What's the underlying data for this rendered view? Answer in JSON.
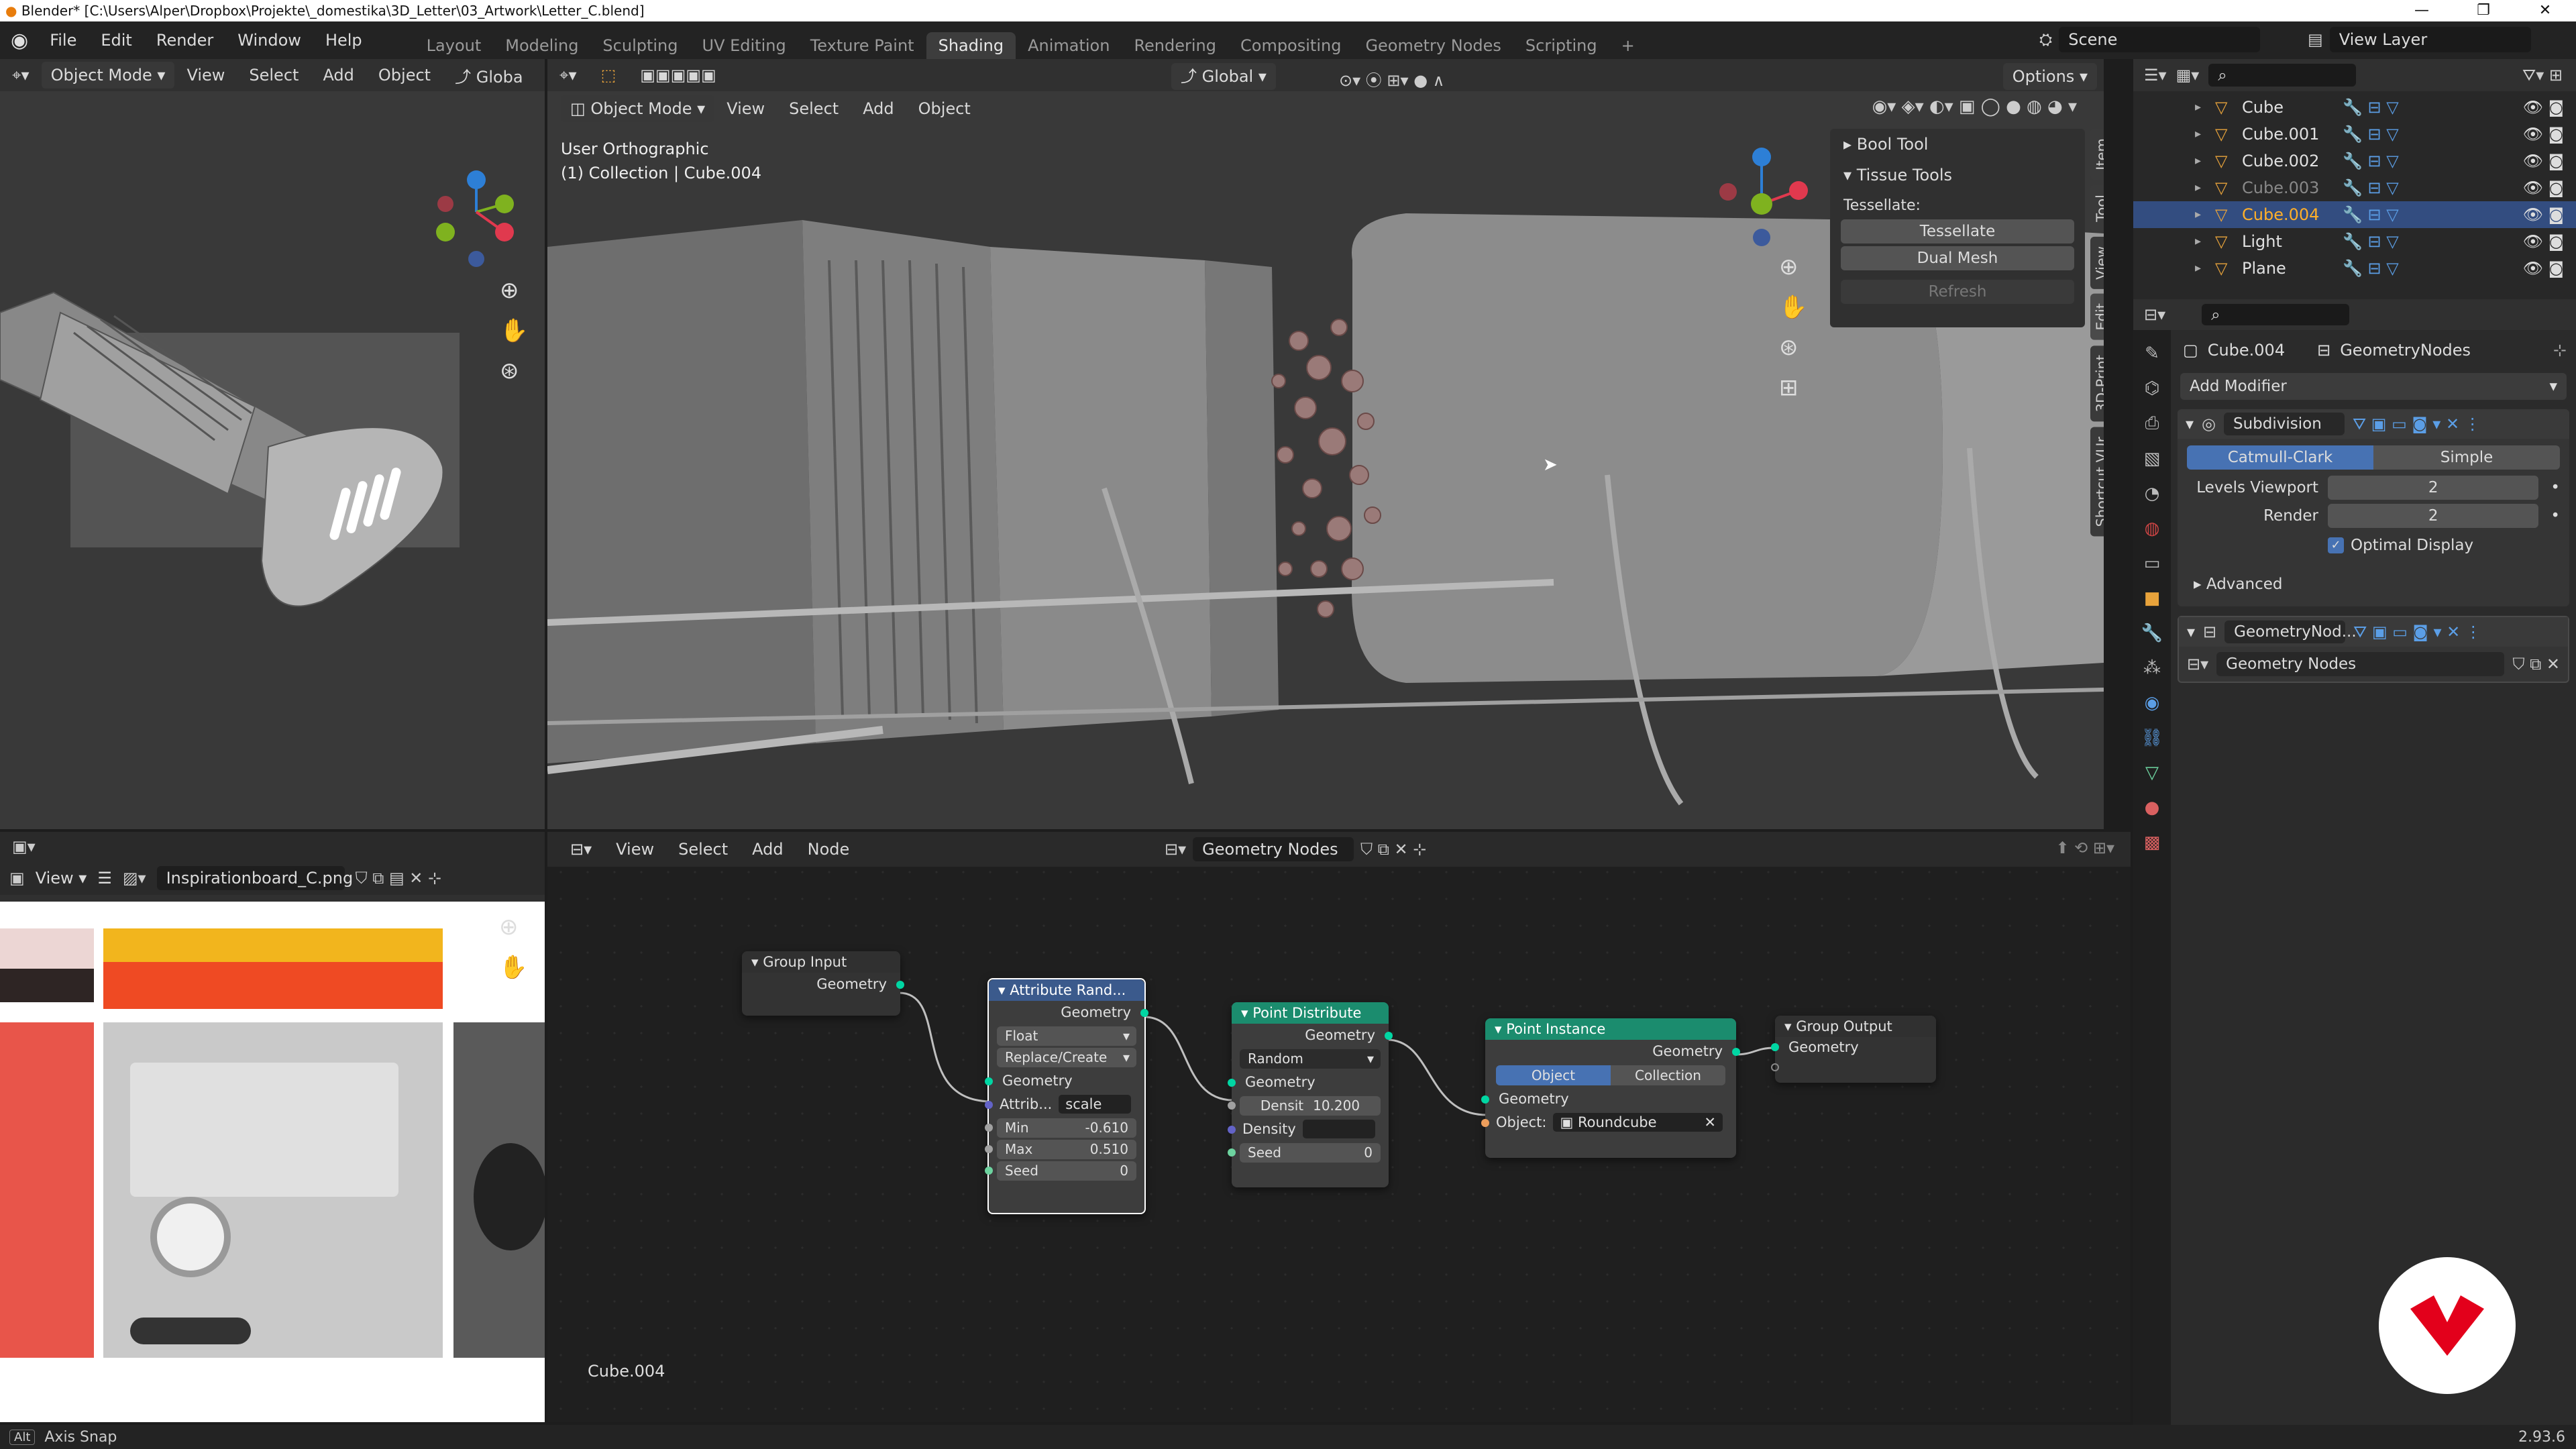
{
  "window": {
    "title": "Blender* [C:\\Users\\Alper\\Dropbox\\Projekte\\_domestika\\3D_Letter\\03_Artwork\\Letter_C.blend]",
    "controls": [
      "—",
      "❐",
      "✕"
    ]
  },
  "menubar": [
    "File",
    "Edit",
    "Render",
    "Window",
    "Help"
  ],
  "workspace_tabs": [
    {
      "label": "Layout",
      "active": false
    },
    {
      "label": "Modeling",
      "active": false
    },
    {
      "label": "Sculpting",
      "active": false
    },
    {
      "label": "UV Editing",
      "active": false
    },
    {
      "label": "Texture Paint",
      "active": false
    },
    {
      "label": "Shading",
      "active": true
    },
    {
      "label": "Animation",
      "active": false
    },
    {
      "label": "Rendering",
      "active": false
    },
    {
      "label": "Compositing",
      "active": false
    },
    {
      "label": "Geometry Nodes",
      "active": false
    },
    {
      "label": "Scripting",
      "active": false
    }
  ],
  "scene": {
    "name": "Scene",
    "view_layer": "View Layer"
  },
  "left_viewport": {
    "mode": "Object Mode",
    "menus": [
      "View",
      "Select",
      "Add",
      "Object"
    ],
    "transform": "Globa"
  },
  "main_viewport": {
    "mode": "Object Mode",
    "menus": [
      "View",
      "Select",
      "Add",
      "Object"
    ],
    "transform_orientation": "Global",
    "options_label": "Options",
    "view_name": "User Orthographic",
    "collection_label": "(1) Collection | Cube.004",
    "sidebar": {
      "bool_tool": "Bool Tool",
      "tissue_tools": "Tissue Tools",
      "tessellate_label": "Tessellate:",
      "buttons": [
        "Tessellate",
        "Dual Mesh",
        "Refresh"
      ]
    },
    "side_tabs": [
      "Item",
      "Tool",
      "View",
      "Edit",
      "3D-Print",
      "Shortcut VUr"
    ]
  },
  "outliner": {
    "items": [
      {
        "name": "Cube",
        "icon": "mesh-object-icon",
        "dim": false,
        "selected": false
      },
      {
        "name": "Cube.001",
        "icon": "mesh-object-icon",
        "dim": false,
        "selected": false
      },
      {
        "name": "Cube.002",
        "icon": "curve-object-icon",
        "dim": false,
        "selected": false
      },
      {
        "name": "Cube.003",
        "icon": "mesh-object-icon",
        "dim": true,
        "selected": false
      },
      {
        "name": "Cube.004",
        "icon": "mesh-object-icon",
        "dim": false,
        "selected": true
      },
      {
        "name": "Light",
        "icon": "light-object-icon",
        "dim": false,
        "selected": false
      },
      {
        "name": "Plane",
        "icon": "mesh-object-icon",
        "dim": false,
        "selected": false
      }
    ]
  },
  "properties": {
    "object_name": "Cube.004",
    "modifier_context": "GeometryNodes",
    "add_modifier": "Add Modifier",
    "subdivision": {
      "name": "Subdivision",
      "type_a": "Catmull-Clark",
      "type_b": "Simple",
      "levels_viewport_label": "Levels Viewport",
      "levels_viewport": "2",
      "render_label": "Render",
      "render": "2",
      "optimal_display": "Optimal Display",
      "advanced": "Advanced"
    },
    "geonodes": {
      "name": "GeometryNod...",
      "tree": "Geometry Nodes"
    }
  },
  "image_editor": {
    "view_menu": "View",
    "image_name": "Inspirationboard_C.png"
  },
  "node_editor": {
    "menus": [
      "View",
      "Select",
      "Add",
      "Node"
    ],
    "tree_name": "Geometry Nodes",
    "object_label": "Cube.004",
    "nodes": {
      "group_input": {
        "title": "Group Input",
        "out": "Geometry"
      },
      "attr_random": {
        "title": "Attribute Rand...",
        "out": "Geometry",
        "type": "Float",
        "mode": "Replace/Create",
        "in_geo": "Geometry",
        "attr_label": "Attrib...",
        "attr_value": "scale",
        "min_label": "Min",
        "min": "-0.610",
        "max_label": "Max",
        "max": "0.510",
        "seed_label": "Seed",
        "seed": "0"
      },
      "point_distribute": {
        "title": "Point Distribute",
        "out": "Geometry",
        "mode": "Random",
        "in_geo": "Geometry",
        "density_label": "Densit",
        "density": "10.200",
        "density2_label": "Density",
        "seed_label": "Seed",
        "seed": "0"
      },
      "point_instance": {
        "title": "Point Instance",
        "out": "Geometry",
        "opt_a": "Object",
        "opt_b": "Collection",
        "in_geo": "Geometry",
        "obj_label": "Object:",
        "obj_value": "Roundcube"
      },
      "group_output": {
        "title": "Group Output",
        "in": "Geometry"
      }
    }
  },
  "statusbar": {
    "hint_key": "Alt",
    "hint": "Axis Snap",
    "version": "2.93.6"
  },
  "colors": {
    "accent_blue": "#4772b3",
    "geo_node": "#1b8c6e",
    "attr_node": "#3b5a8c",
    "selected_row": "#334d80",
    "brand_red": "#e3001b"
  }
}
